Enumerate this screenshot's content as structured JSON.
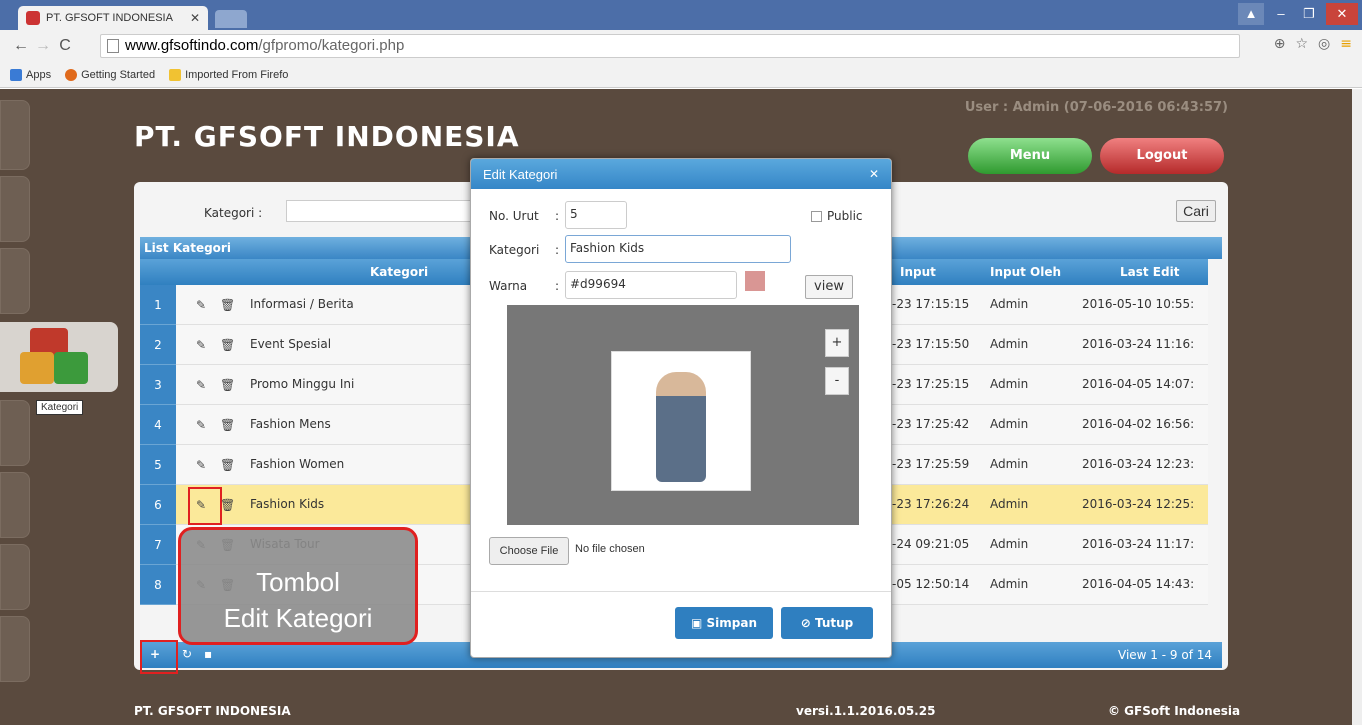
{
  "browser": {
    "tab_title": "PT. GFSOFT INDONESIA",
    "url_host": "www.gfsoftindo.com",
    "url_path": "/gfpromo/kategori.php",
    "bookmarks": [
      "Apps",
      "Getting Started",
      "Imported From Firefo"
    ]
  },
  "header": {
    "brand": "PT. GFSOFT INDONESIA",
    "user_info": "User : Admin (07-06-2016 06:43:57)",
    "menu_label": "Menu",
    "logout_label": "Logout"
  },
  "sidebar": {
    "active_label": "Kategori"
  },
  "search": {
    "label": "Kategori  :",
    "button": "Cari"
  },
  "list": {
    "title": "List Kategori",
    "columns": {
      "kategori": "Kategori",
      "input": "Input",
      "input_oleh": "Input Oleh",
      "last_edit": "Last Edit"
    },
    "rows": [
      {
        "no": "1",
        "name": "Informasi / Berita",
        "input": "-23 17:15:15",
        "by": "Admin",
        "last": "2016-05-10 10:55:"
      },
      {
        "no": "2",
        "name": "Event Spesial",
        "input": "-23 17:15:50",
        "by": "Admin",
        "last": "2016-03-24 11:16:"
      },
      {
        "no": "3",
        "name": "Promo Minggu Ini",
        "input": "-23 17:25:15",
        "by": "Admin",
        "last": "2016-04-05 14:07:"
      },
      {
        "no": "4",
        "name": "Fashion Mens",
        "input": "-23 17:25:42",
        "by": "Admin",
        "last": "2016-04-02 16:56:"
      },
      {
        "no": "5",
        "name": "Fashion Women",
        "input": "-23 17:25:59",
        "by": "Admin",
        "last": "2016-03-24 12:23:"
      },
      {
        "no": "6",
        "name": "Fashion Kids",
        "input": "-23 17:26:24",
        "by": "Admin",
        "last": "2016-03-24 12:25:"
      },
      {
        "no": "7",
        "name": "Wisata Tour",
        "input": "-24 09:21:05",
        "by": "Admin",
        "last": "2016-03-24 11:17:"
      },
      {
        "no": "8",
        "name": "",
        "input": "-05 12:50:14",
        "by": "Admin",
        "last": "2016-04-05 14:43:"
      }
    ],
    "selected_index": 5,
    "pager": "View 1 - 9 of 14"
  },
  "footer": {
    "left": "PT. GFSOFT INDONESIA",
    "version": "versi.1.1.2016.05.25",
    "copyright": "© GFSoft Indonesia"
  },
  "modal": {
    "title": "Edit Kategori",
    "no_urut_label": "No. Urut",
    "no_urut_value": "5",
    "public_label": "Public",
    "kategori_label": "Kategori",
    "kategori_value": "Fashion Kids",
    "warna_label": "Warna",
    "warna_value": "#d99694",
    "warna_color": "#d99694",
    "view_label": "view",
    "zoom_in": "+",
    "zoom_out": "-",
    "choose_file": "Choose File",
    "no_file": "No file chosen",
    "save_label": "Simpan",
    "close_label": "Tutup"
  },
  "annotation": {
    "callout_text_1": "Tombol",
    "callout_text_2": "Edit Kategori"
  }
}
